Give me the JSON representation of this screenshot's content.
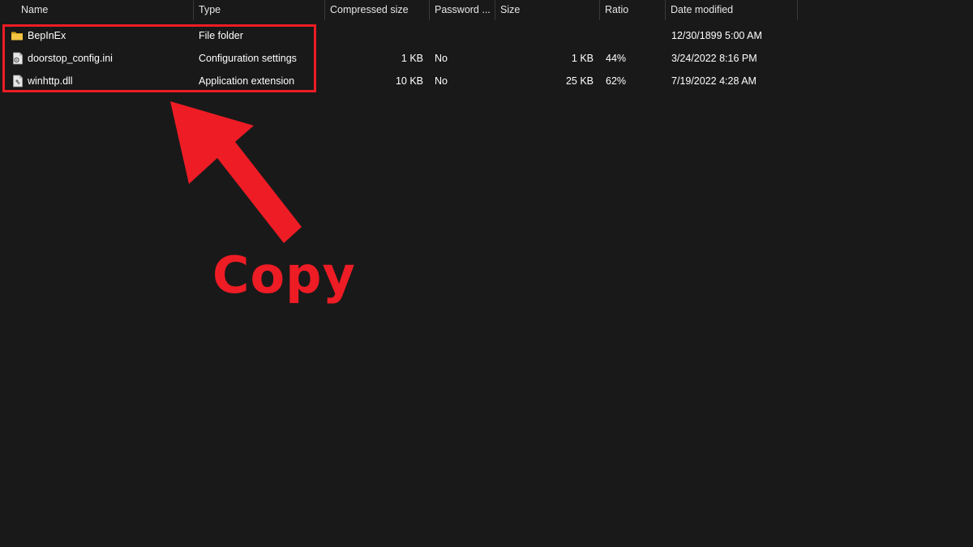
{
  "columns": {
    "name": "Name",
    "type": "Type",
    "compressed": "Compressed size",
    "password": "Password ...",
    "size": "Size",
    "ratio": "Ratio",
    "modified": "Date modified"
  },
  "sort_icon": "chevron-up-icon",
  "files": [
    {
      "icon": "folder-icon",
      "name": "BepInEx",
      "type": "File folder",
      "compressed": "",
      "password": "",
      "size": "",
      "ratio": "",
      "modified": "12/30/1899 5:00 AM"
    },
    {
      "icon": "settings-file-icon",
      "name": "doorstop_config.ini",
      "type": "Configuration settings",
      "compressed": "1 KB",
      "password": "No",
      "size": "1 KB",
      "ratio": "44%",
      "modified": "3/24/2022 8:16 PM"
    },
    {
      "icon": "dll-file-icon",
      "name": "winhttp.dll",
      "type": "Application extension",
      "compressed": "10 KB",
      "password": "No",
      "size": "25 KB",
      "ratio": "62%",
      "modified": "7/19/2022 4:28 AM"
    }
  ],
  "annotation": {
    "label": "Copy",
    "color": "#ee1c25"
  },
  "colors": {
    "background": "#191919",
    "text": "#ffffff",
    "annotation": "#ee1c25",
    "folder": "#f5c542"
  }
}
